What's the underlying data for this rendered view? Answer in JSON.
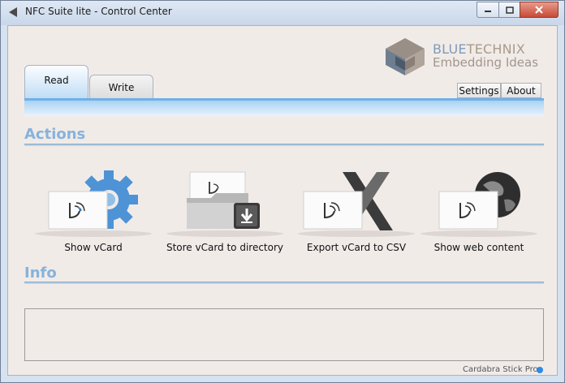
{
  "window": {
    "title": "NFC Suite lite - Control Center"
  },
  "logo": {
    "part1": "BLUE",
    "part2": "TECHNIX",
    "tagline": "Embedding Ideas"
  },
  "tabs": [
    {
      "label": "Read",
      "selected": true
    },
    {
      "label": "Write",
      "selected": false
    }
  ],
  "header_buttons": {
    "settings": "Settings",
    "about": "About"
  },
  "sections": {
    "actions": "Actions",
    "info": "Info"
  },
  "actions": [
    {
      "label": "Show vCard",
      "icon": "gear-icon"
    },
    {
      "label": "Store vCard to directory",
      "icon": "folder-download-icon"
    },
    {
      "label": "Export vCard to CSV",
      "icon": "excel-x-icon"
    },
    {
      "label": "Show web content",
      "icon": "globe-icon"
    }
  ],
  "status": {
    "device": "Cardabra Stick Pro",
    "indicator_color": "#2e8ae6"
  },
  "colors": {
    "accent": "#6fb0e8",
    "section_title": "#86b3dc",
    "background": "#f1ebe8"
  }
}
